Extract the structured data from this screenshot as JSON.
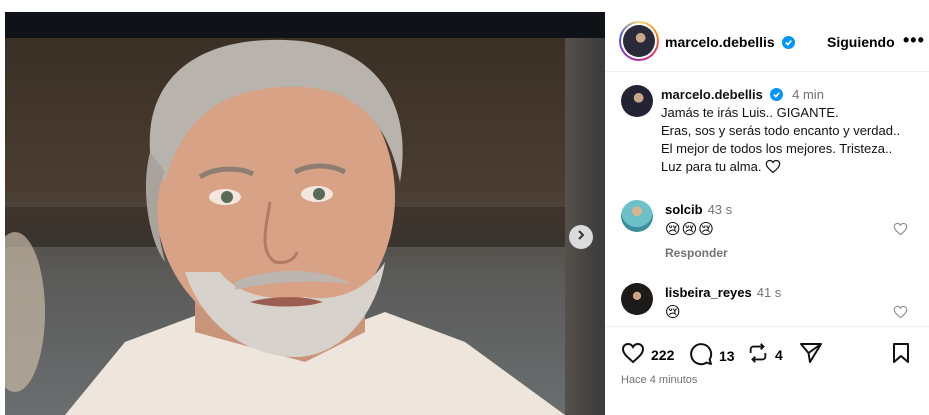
{
  "post": {
    "author": "marcelo.debellis",
    "follow_label": "Siguiendo",
    "more_label": "•••",
    "verified": true
  },
  "caption": {
    "author": "marcelo.debellis",
    "time": "4 min",
    "lines": [
      "Jamás te irás Luis.. GIGANTE.",
      "Eras, sos y serás todo encanto y verdad..",
      "El mejor de todos los mejores. Tristeza..",
      "Luz para tu alma."
    ]
  },
  "comments": [
    {
      "user": "solcib",
      "time": "43 s",
      "text": "😢😢😢",
      "reply_label": "Responder"
    },
    {
      "user": "lisbeira_reyes",
      "time": "41 s",
      "text": "😢"
    }
  ],
  "actions": {
    "likes": "222",
    "comments": "13",
    "reposts": "4"
  },
  "posted_ago": "Hace 4 minutos",
  "colors": {
    "verified": "#0095f6",
    "muted": "#737373"
  }
}
